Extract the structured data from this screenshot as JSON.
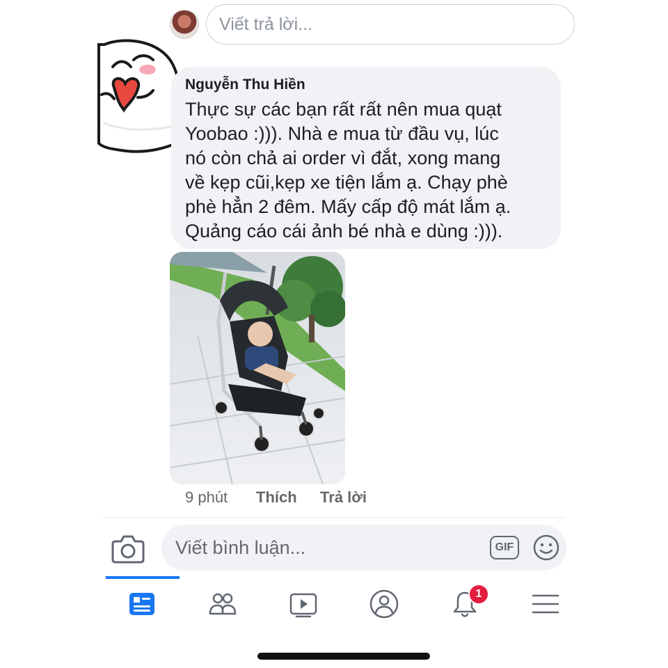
{
  "reply": {
    "placeholder": "Viết trả lời..."
  },
  "comment": {
    "author": "Nguyễn Thu Hiền",
    "text": "Thực sự các bạn rất rất nên mua quạt\nYoobao :))). Nhà e mua từ đầu vụ, lúc\nnó còn chả ai order vì đắt, xong mang\nvề kẹp cũi,kẹp xe tiện lắm ạ. Chạy phè\nphè hẳn 2 đêm. Mấy cấp độ mát lắm ạ.\nQuảng cáo cái ảnh bé nhà e dùng :))).",
    "time": "9 phút",
    "like_label": "Thích",
    "reply_label": "Trả lời"
  },
  "composer": {
    "placeholder": "Viết bình luận...",
    "gif_label": "GIF"
  },
  "nav": {
    "items": [
      {
        "icon": "news-feed-icon",
        "active": true
      },
      {
        "icon": "groups-icon"
      },
      {
        "icon": "watch-icon"
      },
      {
        "icon": "profile-icon"
      },
      {
        "icon": "notifications-icon"
      },
      {
        "icon": "menu-icon"
      }
    ],
    "notification_count": "1"
  },
  "colors": {
    "accent": "#1877f2",
    "badge": "#e41e3f",
    "bubble": "#f0f2f5",
    "meta_text": "#65676b"
  }
}
